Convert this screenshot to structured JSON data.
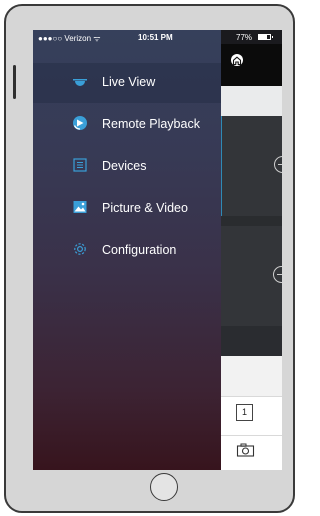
{
  "status_bar": {
    "carrier": "●●●○○ Verizon ᯤ",
    "time": "10:51 PM",
    "battery": "77%"
  },
  "menu": {
    "items": [
      {
        "label": "Live View",
        "icon": "dome-camera-icon",
        "active": true
      },
      {
        "label": "Remote Playback",
        "icon": "playback-icon",
        "active": false
      },
      {
        "label": "Devices",
        "icon": "devices-list-icon",
        "active": false
      },
      {
        "label": "Picture & Video",
        "icon": "picture-icon",
        "active": false
      },
      {
        "label": "Configuration",
        "icon": "gear-icon",
        "active": false
      }
    ]
  },
  "content": {
    "layout_button": "1",
    "top_icon": "home-icon",
    "snapshot_icon": "camera-icon"
  },
  "colors": {
    "accent_blue": "#3a9fd8",
    "menu_top": "#36405b",
    "menu_bottom": "#37141d"
  }
}
